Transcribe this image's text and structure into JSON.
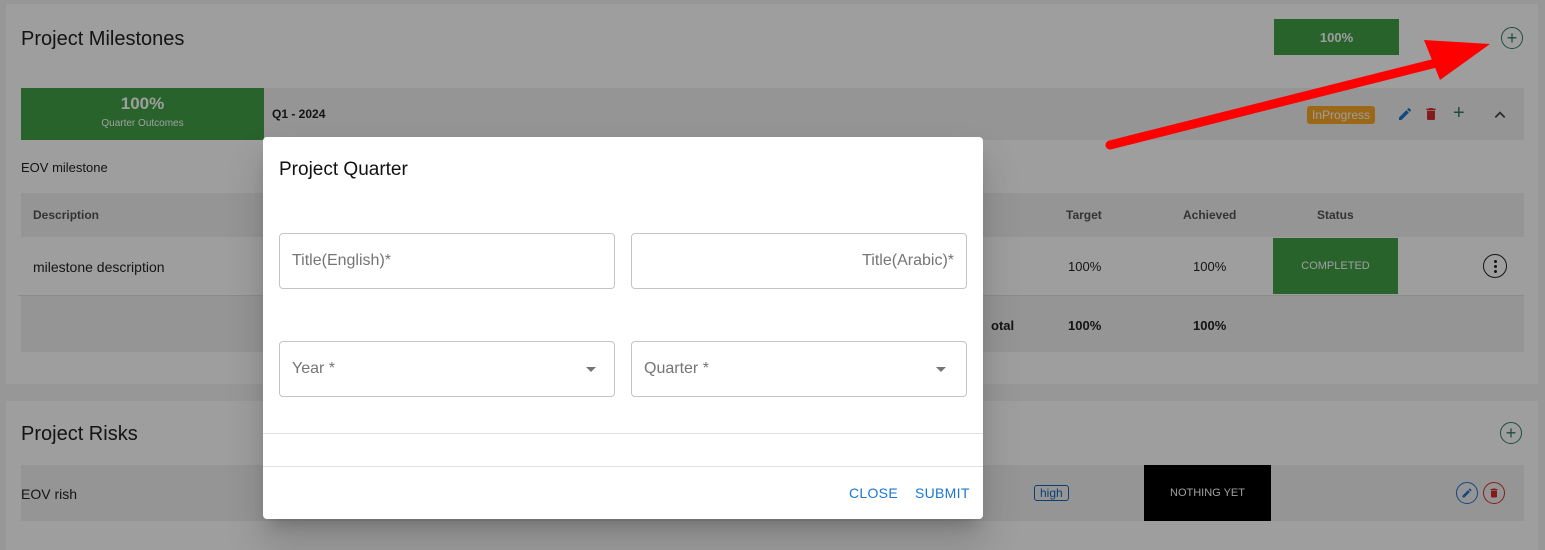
{
  "milestones": {
    "title": "Project Milestones",
    "overall_percent": "100%",
    "quarter": {
      "outcome_percent": "100%",
      "outcome_label": "Quarter Outcomes",
      "name": "Q1 - 2024",
      "status": "InProgress"
    },
    "milestone_name": "EOV milestone",
    "table": {
      "headers": [
        "Description",
        "Target",
        "Achieved",
        "Status"
      ],
      "row": {
        "description": "milestone description",
        "target": "100%",
        "achieved": "100%",
        "status": "COMPLETED"
      },
      "total": {
        "label": "otal",
        "target": "100%",
        "achieved": "100%"
      }
    }
  },
  "risks": {
    "title": "Project Risks",
    "row": {
      "name": "EOV rish",
      "level": "high",
      "status": "NOTHING YET"
    }
  },
  "dialog": {
    "title": "Project Quarter",
    "title_english_placeholder": "Title(English)*",
    "title_arabic_placeholder": "Title(Arabic)*",
    "year_placeholder": "Year *",
    "quarter_placeholder": "Quarter *",
    "close_label": "CLOSE",
    "submit_label": "SUBMIT"
  },
  "colors": {
    "accent_green": "#43a047",
    "primary_blue": "#1976d2",
    "warning_orange": "#f9a825",
    "delete_red": "#d32f2f",
    "annotation_red": "#ff0000"
  }
}
